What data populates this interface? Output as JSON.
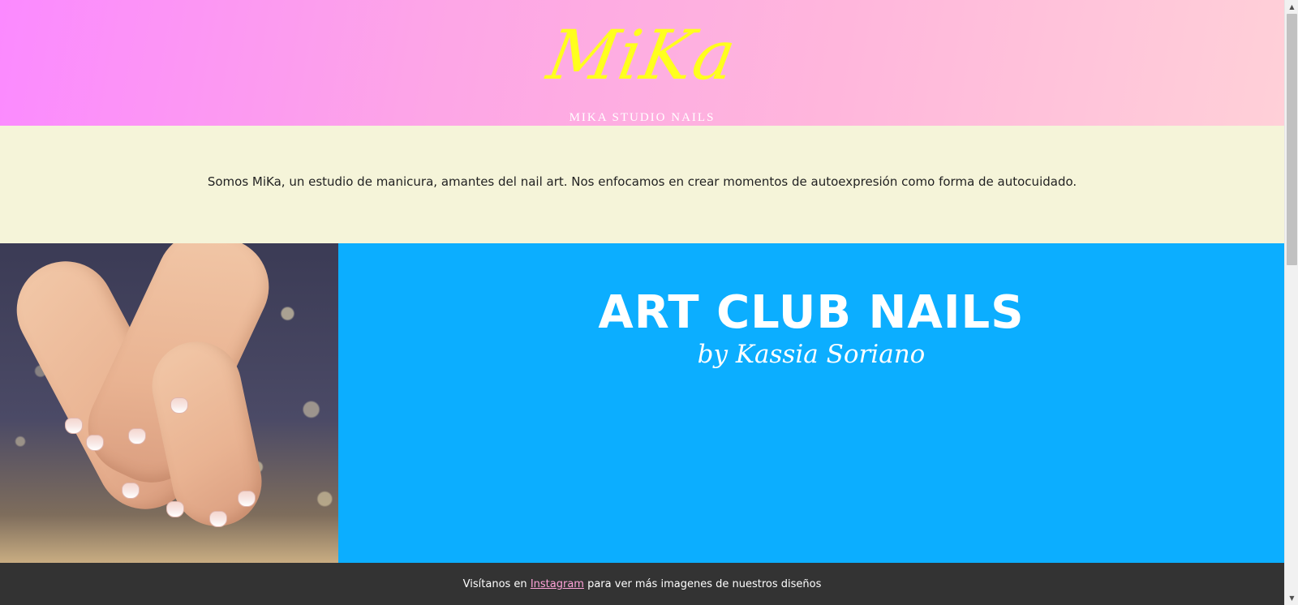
{
  "header": {
    "logo": "MiKa",
    "studio_name": "MIKA STUDIO NAILS"
  },
  "intro": {
    "text": "Somos MiKa, un estudio de manicura, amantes del nail art. Nos enfocamos en crear momentos de autoexpresión como forma de autocuidado."
  },
  "feature": {
    "title": "ART CLUB NAILS",
    "subtitle": "by Kassia Soriano",
    "image": "photo of hands with french manicure nails on glitter background"
  },
  "footer": {
    "text_before": "Visítanos en",
    "link_label": "Instagram",
    "text_after": "para ver más imagenes de nuestros diseños"
  },
  "colors": {
    "logo": "#ffff1e",
    "intro_bg": "#f5f4d9",
    "promo_bg": "#0caeff",
    "footer_bg": "#333333",
    "link": "#ffa3d8"
  }
}
